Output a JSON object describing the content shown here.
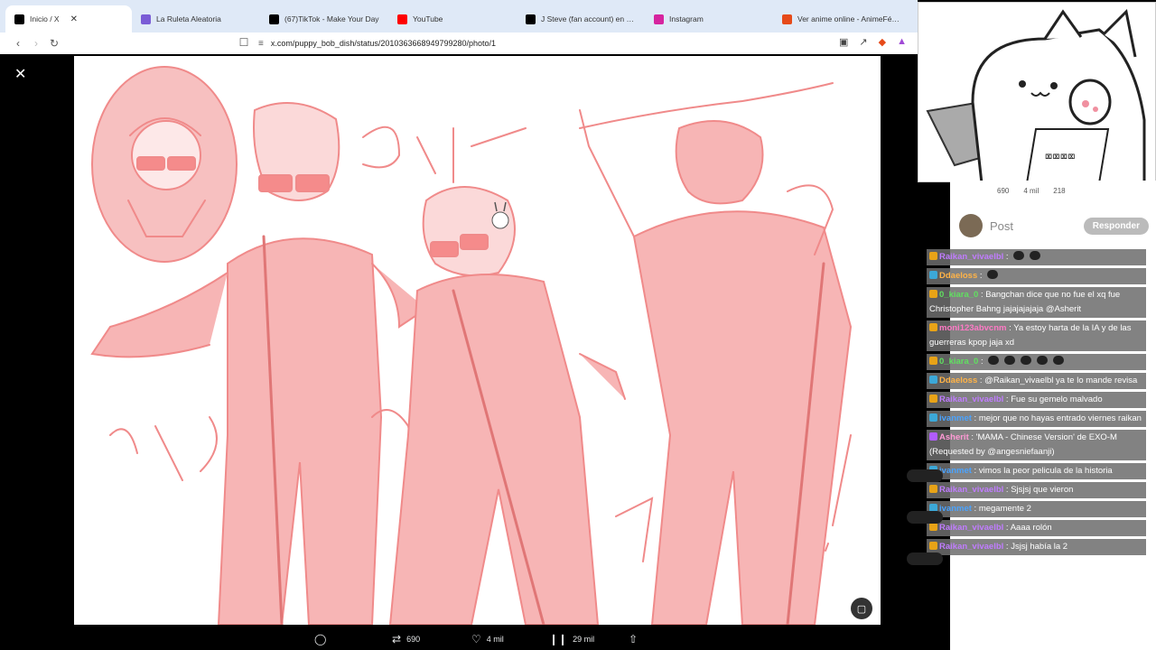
{
  "browser": {
    "tabs": [
      {
        "label": "Inicio / X",
        "active": true,
        "icon": "x-logo-icon",
        "color": "#000000"
      },
      {
        "label": "La Ruleta Aleatoria",
        "active": false,
        "icon": "wheel-icon",
        "color": "#7a5cd6"
      },
      {
        "label": "(67)TikTok - Make Your Day",
        "active": false,
        "icon": "tiktok-icon",
        "color": "#000000"
      },
      {
        "label": "YouTube",
        "active": false,
        "icon": "youtube-icon",
        "color": "#ff0000"
      },
      {
        "label": "J Steve (fan account) en X: \"wf",
        "active": false,
        "icon": "x-logo-icon",
        "color": "#000000"
      },
      {
        "label": "Instagram",
        "active": false,
        "icon": "instagram-icon",
        "color": "#d6249f"
      },
      {
        "label": "Ver anime online - AnimeFénix",
        "active": false,
        "icon": "phoenix-icon",
        "color": "#e64a19"
      }
    ],
    "url": "x.com/puppy_bob_dish/status/2010363668949799280/photo/1"
  },
  "post": {
    "reposts": "690",
    "likes": "4 mil",
    "views": "29 mil",
    "reply_label": "Responder",
    "post_label": "Post"
  },
  "tweet_strip": {
    "replies": "",
    "reposts": "690",
    "likes": "4 mil",
    "views": "218"
  },
  "chat": [
    {
      "user": "Raikan_vivaelbl",
      "text": "",
      "user_color": "#c07cff",
      "badge": "#e8a317",
      "emotes": 2
    },
    {
      "user": "Ddaeloss",
      "text": "",
      "user_color": "#ffb347",
      "badge": "#3ca8d8",
      "emotes": 1
    },
    {
      "user": "0_kiara_0",
      "text": "Bangchan dice que no fue el xq fue Christopher Bahng jajajajajaja @Asherit",
      "user_color": "#60e060",
      "badge": "#e8a317",
      "emotes": 0
    },
    {
      "user": "moni123abvcnm",
      "text": "Ya estoy harta de la IA y de las guerreras kpop jaja xd",
      "user_color": "#ff7ac6",
      "badge": "#e8a317",
      "emotes": 0
    },
    {
      "user": "0_kiara_0",
      "text": "",
      "user_color": "#60e060",
      "badge": "#e8a317",
      "emotes": 5
    },
    {
      "user": "Ddaeloss",
      "text": "@Raikan_vivaelbl ya te lo mande revisa",
      "user_color": "#ffb347",
      "badge": "#3ca8d8",
      "emotes": 0
    },
    {
      "user": "Raikan_vivaelbl",
      "text": "Fue su gemelo malvado",
      "user_color": "#c07cff",
      "badge": "#e8a317",
      "emotes": 0
    },
    {
      "user": "ivanmet",
      "text": "mejor que no hayas entrado viernes raikan",
      "user_color": "#4aa3ff",
      "badge": "#3ca8d8",
      "emotes": 0
    },
    {
      "user": "Asherit",
      "text": "'MAMA - Chinese Version' de EXO-M (Requested by @angesniefaanji)",
      "user_color": "#ff9ad5",
      "badge": "#b15cff",
      "emotes": 0
    },
    {
      "user": "ivanmet",
      "text": "vimos la peor pelicula de la historia",
      "user_color": "#4aa3ff",
      "badge": "#3ca8d8",
      "emotes": 0
    },
    {
      "user": "Raikan_vivaelbl",
      "text": "Sjsjsj que vieron",
      "user_color": "#c07cff",
      "badge": "#e8a317",
      "emotes": 0
    },
    {
      "user": "ivanmet",
      "text": "megamente 2",
      "user_color": "#4aa3ff",
      "badge": "#3ca8d8",
      "emotes": 0
    },
    {
      "user": "Raikan_vivaelbl",
      "text": "Aaaa rolón",
      "user_color": "#c07cff",
      "badge": "#e8a317",
      "emotes": 0
    },
    {
      "user": "Raikan_vivaelbl",
      "text": "Jsjsj había la 2",
      "user_color": "#c07cff",
      "badge": "#e8a317",
      "emotes": 0
    }
  ],
  "colors": {
    "sketch": "#f08a8a",
    "sketch_fill": "#f7b5b5",
    "accent_blue": "#1a73e8"
  }
}
